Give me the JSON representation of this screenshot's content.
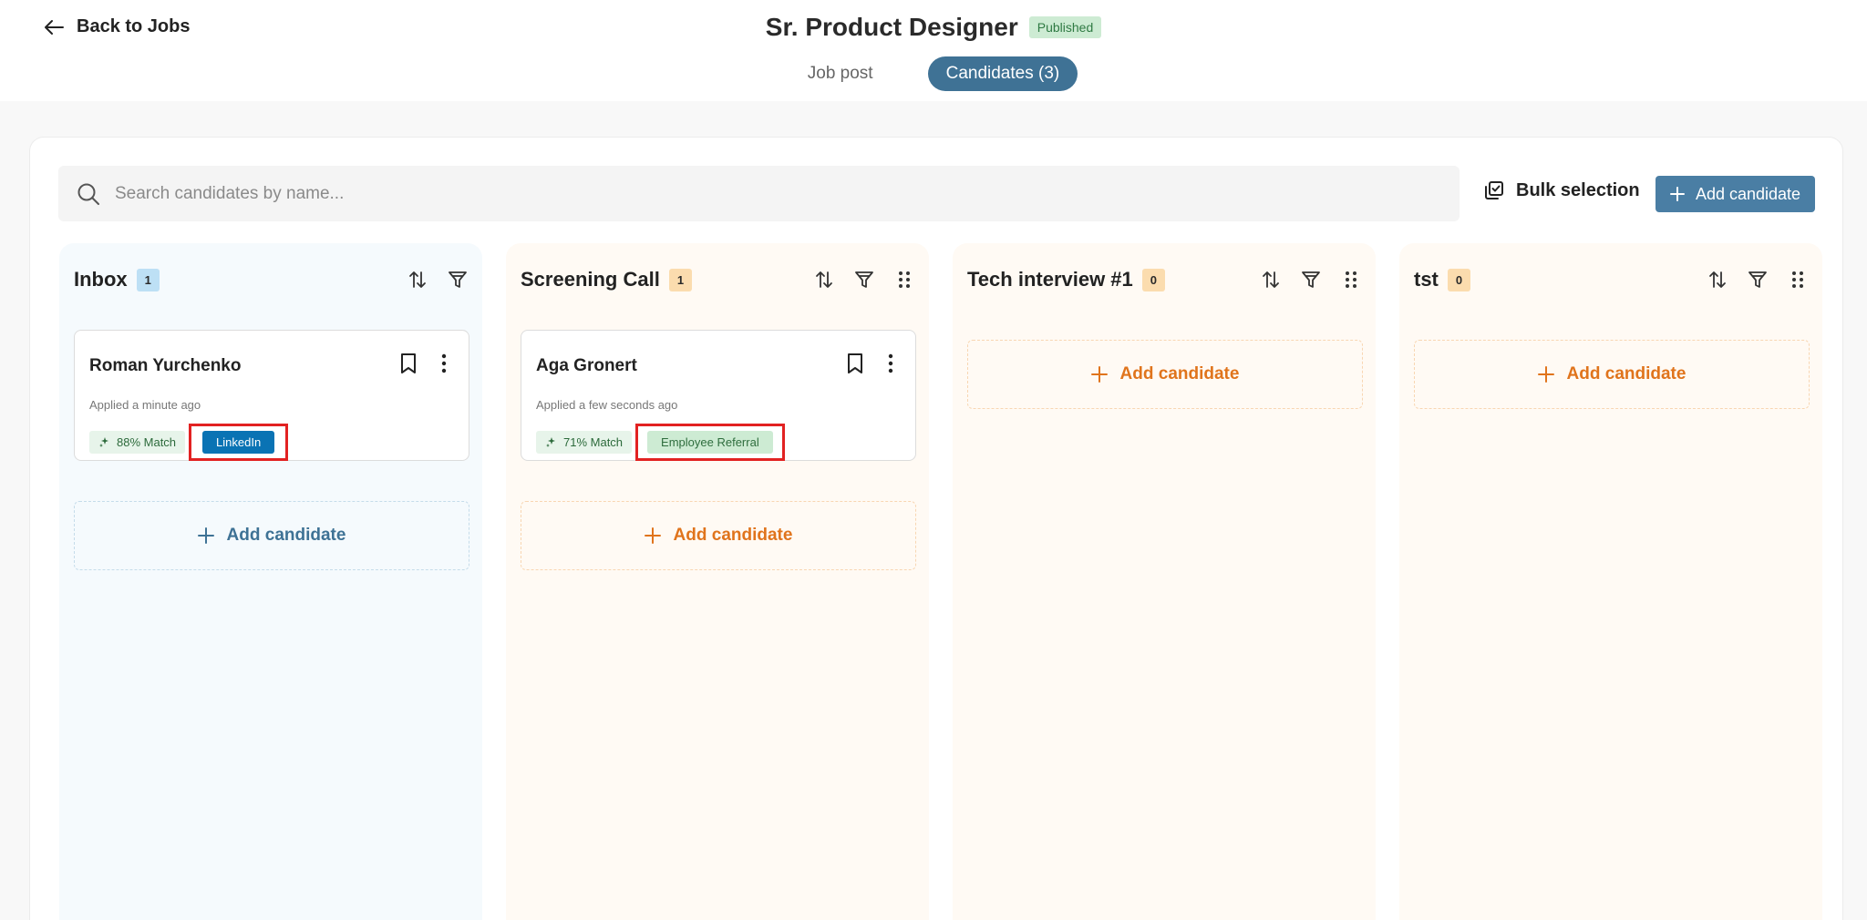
{
  "header": {
    "back_label": "Back to Jobs",
    "title": "Sr. Product Designer",
    "status": "Published"
  },
  "tabs": [
    {
      "label": "Job post",
      "active": false
    },
    {
      "label": "Candidates (3)",
      "active": true
    }
  ],
  "toolbar": {
    "search_placeholder": "Search candidates by name...",
    "bulk_label": "Bulk selection",
    "add_label": "Add candidate"
  },
  "columns": [
    {
      "title": "Inbox",
      "count": "1",
      "theme": "blue",
      "add_label": "Add candidate",
      "cards": [
        {
          "name": "Roman Yurchenko",
          "applied": "Applied a minute ago",
          "match": "88% Match",
          "source": "LinkedIn"
        }
      ]
    },
    {
      "title": "Screening Call",
      "count": "1",
      "theme": "peach",
      "add_label": "Add candidate",
      "cards": [
        {
          "name": "Aga Gronert",
          "applied": "Applied a few seconds ago",
          "match": "71% Match",
          "source": "Employee Referral"
        }
      ]
    },
    {
      "title": "Tech interview #1",
      "count": "0",
      "theme": "peach",
      "add_label": "Add candidate",
      "cards": []
    },
    {
      "title": "tst",
      "count": "0",
      "theme": "peach",
      "add_label": "Add candidate",
      "cards": []
    }
  ],
  "colors": {
    "accent": "#3f7295",
    "add_button": "#4a7ea4",
    "linkedin": "#0a73b4",
    "highlight": "#e22222",
    "orange": "#e0741c"
  }
}
